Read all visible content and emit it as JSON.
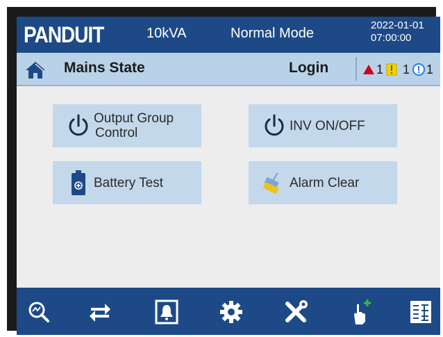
{
  "header": {
    "brand": "PANDUIT",
    "rating": "10kVA",
    "mode": "Normal Mode",
    "date": "2022-01-01",
    "time": "07:00:00"
  },
  "status": {
    "title": "Mains State",
    "login": "Login",
    "alarms": {
      "critical_count": "1",
      "major_count": "1",
      "info_count": "1"
    }
  },
  "buttons": [
    {
      "label": "Output Group Control",
      "line1": "Output Group",
      "line2": "Control",
      "icon": "power-icon"
    },
    {
      "label": "INV ON/OFF",
      "icon": "power-icon"
    },
    {
      "label": "Battery Test",
      "icon": "battery-icon"
    },
    {
      "label": "Alarm Clear",
      "icon": "broom-icon"
    }
  ],
  "toolbar": {
    "icons": [
      "monitor-search-icon",
      "transfer-arrows-icon",
      "alarm-bell-icon",
      "settings-gear-icon",
      "maintenance-tools-icon",
      "touch-add-icon",
      "log-icon"
    ]
  },
  "colors": {
    "header_bg": "#1d4a86",
    "status_bg": "#b9d2e8",
    "button_bg": "#c3d8ea",
    "body_bg": "#ededed",
    "critical": "#d0021b",
    "major": "#f5d000",
    "info": "#2b7de0"
  }
}
